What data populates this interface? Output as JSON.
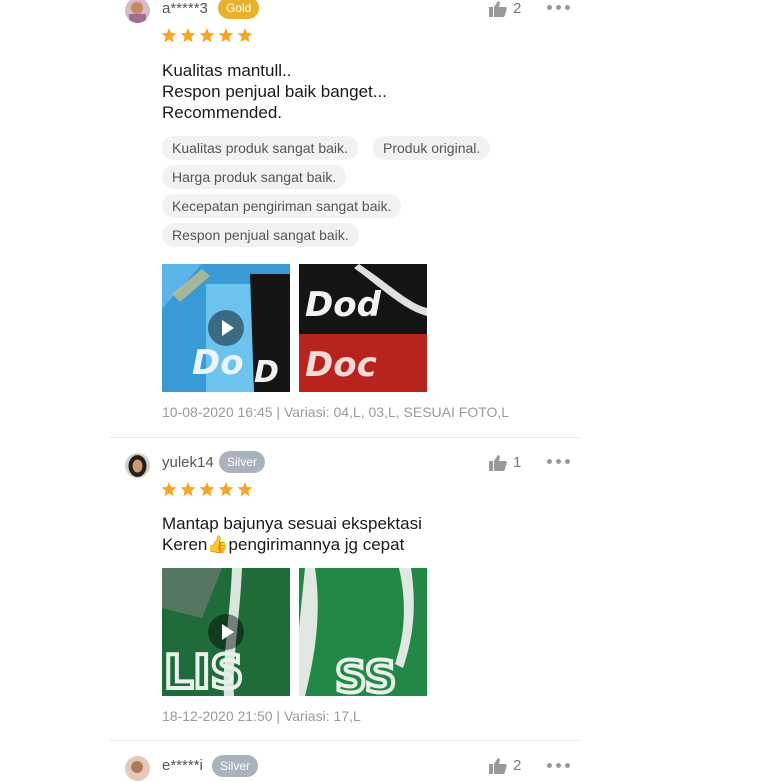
{
  "reviews": [
    {
      "username": "a*****3",
      "badge": "Gold",
      "likes": "2",
      "rating": 5,
      "text_lines": [
        "Kualitas mantull..",
        "Respon penjual baik banget...",
        "Recommended."
      ],
      "tags": [
        "Kualitas produk sangat baik.",
        "Produk original.",
        "Harga produk sangat baik.",
        "Kecepatan pengiriman sangat baik.",
        "Respon penjual sangat baik."
      ],
      "media": [
        {
          "type": "video",
          "desc": "blue and black jerseys"
        },
        {
          "type": "photo",
          "desc": "black and red jerseys"
        }
      ],
      "meta": "10-08-2020 16:45 | Variasi: 04,L, 03,L, SESUAI FOTO,L"
    },
    {
      "username": "yulek14",
      "badge": "Silver",
      "likes": "1",
      "rating": 5,
      "text_lines": [
        "Mantap bajunya sesuai ekspektasi",
        "Keren👍pengirimannya jg cepat"
      ],
      "media": [
        {
          "type": "video",
          "desc": "green jersey"
        },
        {
          "type": "photo",
          "desc": "green jersey"
        }
      ],
      "meta": "18-12-2020 21:50 | Variasi: 17,L"
    },
    {
      "username": "e*****i",
      "badge": "Silver",
      "likes": "2"
    }
  ],
  "colors": {
    "star": "#f5a623",
    "gold_badge": "#e9b12b",
    "silver_badge": "#a9b2bd"
  },
  "icons": {
    "like": "thumbs-up-icon",
    "more": "more-dots-icon",
    "play": "play-icon",
    "star": "star-icon"
  }
}
